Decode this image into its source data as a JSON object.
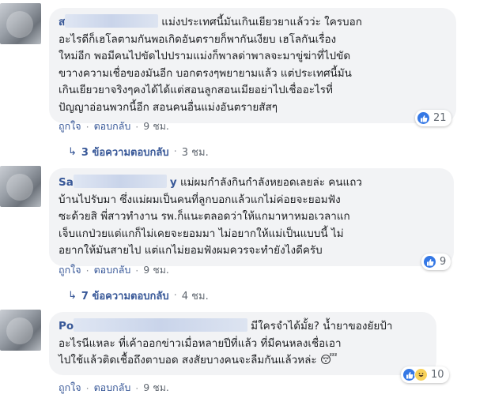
{
  "comments": [
    {
      "author_visible": "ส",
      "lines": [
        "แม่งประเทศนี้มันเกินเยียวยาแล้วว่ะ ใครบอก",
        "อะไรดีก็เฮโลตามกันพอเกิดอันตรายก็พากันเงียบ เฮโลกันเรื่อง",
        "ใหม่อีก พอมีคนไปขัดไปปรามแม่งก็พาลด่าพาลจะมาขู่ฆ่าที่ไปขัด",
        "ขวางความเชื่อของมันอีก บอกตรงๆพยายามแล้ว แต่ประเทศนี้มัน",
        "เกินเยียวยาจริงๆคงได้ได้แต่สอนลูกสอนเมียอย่าไปเชื่ออะไรที่",
        "ปัญญาอ่อนพวกนี้อีก สอนคนอื่นแม่งอันตรายสัสๆ"
      ],
      "reaction_count": "21",
      "reaction_types": [
        "like"
      ],
      "action_like": "ถูกใจ",
      "action_reply": "ตอบกลับ",
      "time": "9 ชม.",
      "replies_label": "3 ข้อความตอบกลับ",
      "replies_time": "3 ชม."
    },
    {
      "author_visible": "Sa",
      "author_tail": "y",
      "lines": [
        "แม่ผมกำลังกินกำลังหยอดเลยล่ะ คนแถว",
        "บ้านไปรับมา ซึ่งแม่ผมเป็นคนที่ลูกบอกแล้วแกไม่ค่อยจะยอมฟัง",
        "ซะด้วยสิ พี่สาวทำงาน รพ.ก็แนะตลอดว่าให้แกมาหาหมอเวลาแก",
        "เจ็บแกป่วยแต่แกก็ไม่เคยจะยอมมา ไม่อยากให้แม่เป็นแบบนี้ ไม่",
        "อยากให้มันสายไป แต่แกไม่ยอมฟังผมควรจะทำยังไงดีครับ"
      ],
      "reaction_count": "9",
      "reaction_types": [
        "like"
      ],
      "action_like": "ถูกใจ",
      "action_reply": "ตอบกลับ",
      "time": "9 ชม.",
      "replies_label": "7 ข้อความตอบกลับ",
      "replies_time": "4 ชม."
    },
    {
      "author_visible": "Po",
      "lines": [
        "มีใครจำได้มั้ย? น้ำยาของยัยป้า",
        "อะไรนีแหละ ที่เค้าออกข่าวเมื่อหลายปีที่แล้ว ที่มีคนหลงเชื่อเอา",
        "ไปใช้แล้วติดเชื้อถึงตาบอด สงสัยบางคนจะลืมกันแล้วหล่ะ"
      ],
      "emoji": "😴",
      "reaction_count": "10",
      "reaction_types": [
        "like",
        "haha"
      ],
      "action_like": "ถูกใจ",
      "action_reply": "ตอบกลับ",
      "time": "9 ชม."
    }
  ],
  "colors": {
    "link": "#385898",
    "bubble": "#f2f3f5",
    "like_blue": "#3578e5",
    "meta_gray": "#606770"
  }
}
